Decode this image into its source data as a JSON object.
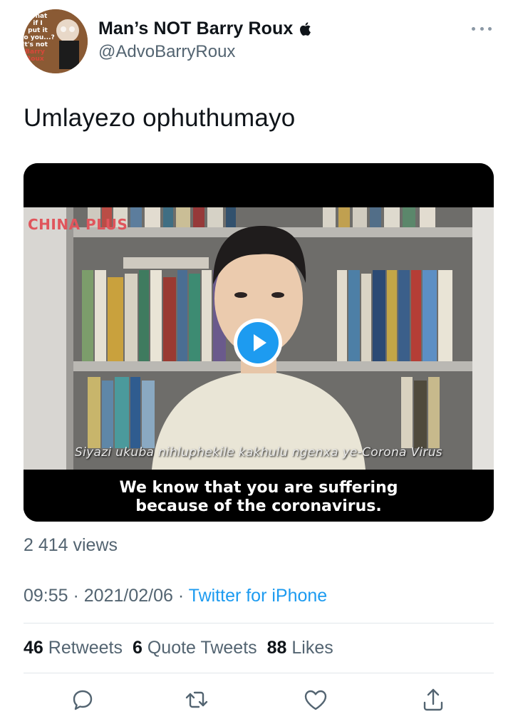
{
  "author": {
    "display_name": "Man’s NOT Barry Roux",
    "handle": "@AdvoBarryRoux",
    "verified_badge_icon": "apple-icon",
    "avatar_caption": [
      "What",
      "if I",
      "put it",
      "to you...?",
      "It's not",
      "Barry",
      "Roux"
    ]
  },
  "tweet": {
    "text": "Umlayezo ophuthumayo"
  },
  "media": {
    "brand": "CHINA PLUS",
    "subtitle_native": "Siyazi ukuba nihluphekile kakhulu ngenxa ye-Corona Virus",
    "subtitle_en_line1": "We know that you are suffering",
    "subtitle_en_line2": "because of the coronavirus.",
    "play_icon": "play-icon"
  },
  "views": "2 414 views",
  "meta": {
    "time": "09:55",
    "separator": " · ",
    "date": "2021/02/06",
    "source": "Twitter for iPhone"
  },
  "stats": {
    "retweets_count": "46",
    "retweets_label": "Retweets",
    "quotes_count": "6",
    "quotes_label": "Quote Tweets",
    "likes_count": "88",
    "likes_label": "Likes"
  },
  "actions": [
    "reply-icon",
    "retweet-icon",
    "like-icon",
    "share-icon"
  ],
  "colors": {
    "text": "#0f1419",
    "secondary": "#536471",
    "accent": "#1d9bf0",
    "divider": "#e1e6ea"
  }
}
